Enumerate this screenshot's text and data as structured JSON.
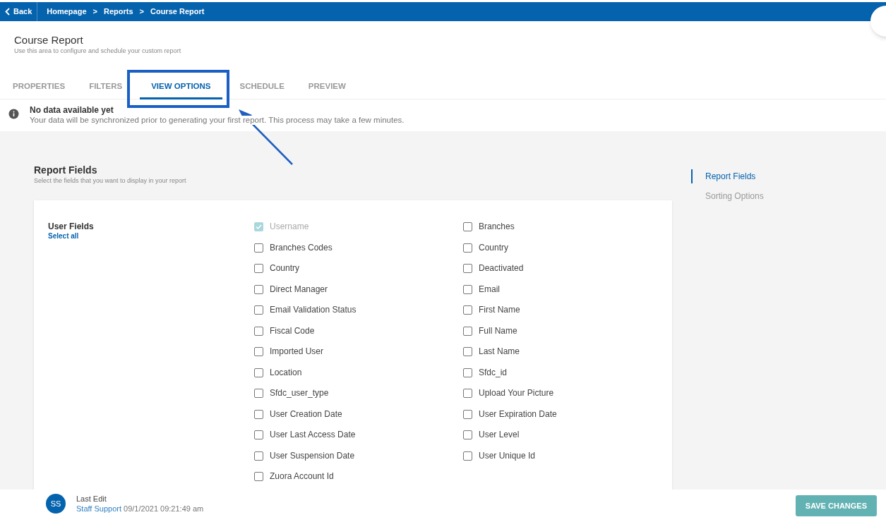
{
  "top_bar": {
    "back": "Back",
    "breadcrumbs": [
      {
        "label": "Homepage"
      },
      {
        "label": "Reports"
      },
      {
        "label": "Course Report"
      }
    ],
    "separator": ">"
  },
  "header": {
    "title": "Course Report",
    "subtitle": "Use this area to configure and schedule your custom report"
  },
  "tabs": [
    {
      "label": "PROPERTIES",
      "selected": false
    },
    {
      "label": "FILTERS",
      "selected": false
    },
    {
      "label": "VIEW OPTIONS",
      "selected": true
    },
    {
      "label": "SCHEDULE",
      "selected": false
    },
    {
      "label": "PREVIEW",
      "selected": false
    }
  ],
  "notice": {
    "title": "No data available yet",
    "message": "Your data will be synchronized prior to generating your first report. This process may take a few minutes."
  },
  "section": {
    "title": "Report Fields",
    "subtitle": "Select the fields that you want to display in your report"
  },
  "side_nav": [
    {
      "label": "Report Fields",
      "selected": true
    },
    {
      "label": "Sorting Options",
      "selected": false
    }
  ],
  "group": {
    "title": "User Fields",
    "select_all": "Select all",
    "columns": [
      [
        {
          "label": "Username",
          "checked": true,
          "disabled": true
        },
        {
          "label": "Branches Codes",
          "checked": false,
          "disabled": false
        },
        {
          "label": "Country",
          "checked": false,
          "disabled": false
        },
        {
          "label": "Direct Manager",
          "checked": false,
          "disabled": false
        },
        {
          "label": "Email Validation Status",
          "checked": false,
          "disabled": false
        },
        {
          "label": "Fiscal Code",
          "checked": false,
          "disabled": false
        },
        {
          "label": "Imported User",
          "checked": false,
          "disabled": false
        },
        {
          "label": "Location",
          "checked": false,
          "disabled": false
        },
        {
          "label": "Sfdc_user_type",
          "checked": false,
          "disabled": false
        },
        {
          "label": "User Creation Date",
          "checked": false,
          "disabled": false
        },
        {
          "label": "User Last Access Date",
          "checked": false,
          "disabled": false
        },
        {
          "label": "User Suspension Date",
          "checked": false,
          "disabled": false
        },
        {
          "label": "Zuora Account Id",
          "checked": false,
          "disabled": false
        }
      ],
      [
        {
          "label": "Branches",
          "checked": false,
          "disabled": false
        },
        {
          "label": "Country",
          "checked": false,
          "disabled": false
        },
        {
          "label": "Deactivated",
          "checked": false,
          "disabled": false
        },
        {
          "label": "Email",
          "checked": false,
          "disabled": false
        },
        {
          "label": "First Name",
          "checked": false,
          "disabled": false
        },
        {
          "label": "Full Name",
          "checked": false,
          "disabled": false
        },
        {
          "label": "Last Name",
          "checked": false,
          "disabled": false
        },
        {
          "label": "Sfdc_id",
          "checked": false,
          "disabled": false
        },
        {
          "label": "Upload Your Picture",
          "checked": false,
          "disabled": false
        },
        {
          "label": "User Expiration Date",
          "checked": false,
          "disabled": false
        },
        {
          "label": "User Level",
          "checked": false,
          "disabled": false
        },
        {
          "label": "User Unique Id",
          "checked": false,
          "disabled": false
        }
      ]
    ]
  },
  "footer": {
    "initials": "SS",
    "label": "Last Edit",
    "user": "Staff Support",
    "timestamp": "09/1/2021 09:21:49 am",
    "save": "SAVE CHANGES"
  }
}
